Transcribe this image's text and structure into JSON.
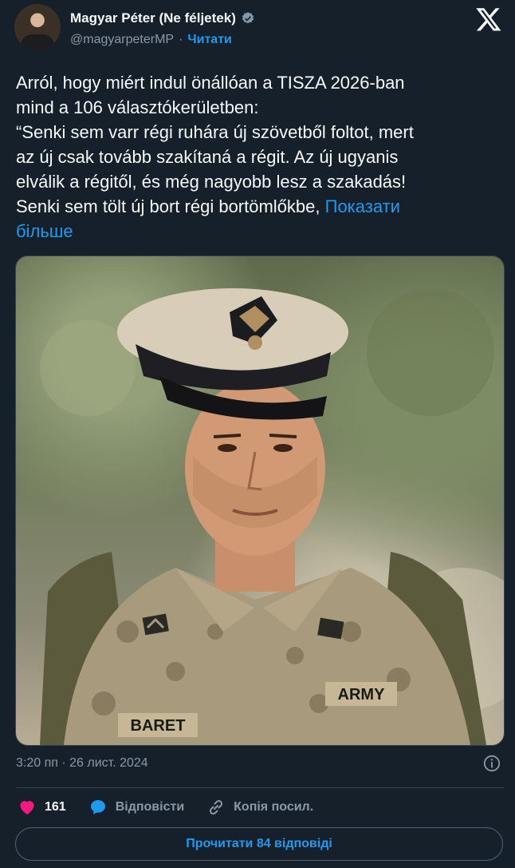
{
  "author": {
    "name": "Magyar Péter (Ne féljetek)",
    "handle": "@magyarpeterMP",
    "separator": "·",
    "follow_label": "Читати"
  },
  "tweet": {
    "text": "Arról, hogy miért indul önállóan a TISZA 2026-ban\nmind a 106 választókerületben:\n“Senki sem varr régi ruhára új szövetből foltot, mert\naz új csak tovább szakítaná a régit. Az új ugyanis\nelválik a régitől, és még nagyobb lesz a szakadás!\nSenki sem tölt új bort régi bortömlőkbe, ",
    "show_more": "Показати\nбільше"
  },
  "media": {
    "cap_badge": "",
    "name_tape": "BARET",
    "army_tape": "ARMY"
  },
  "meta": {
    "timestamp": "3:20 пп · 26 лист. 2024"
  },
  "actions": {
    "likes": "161",
    "reply_label": "Відповісти",
    "copy_label": "Копія посил."
  },
  "read_replies_label": "Прочитати 84 відповіді",
  "icons": [
    "verified-icon",
    "x-logo-icon",
    "info-icon",
    "heart-icon",
    "reply-bubble-icon",
    "link-icon"
  ],
  "colors": {
    "background": "#15202b",
    "accent": "#1d9bf0",
    "secondary_text": "#8b98a5",
    "like": "#f91880"
  }
}
